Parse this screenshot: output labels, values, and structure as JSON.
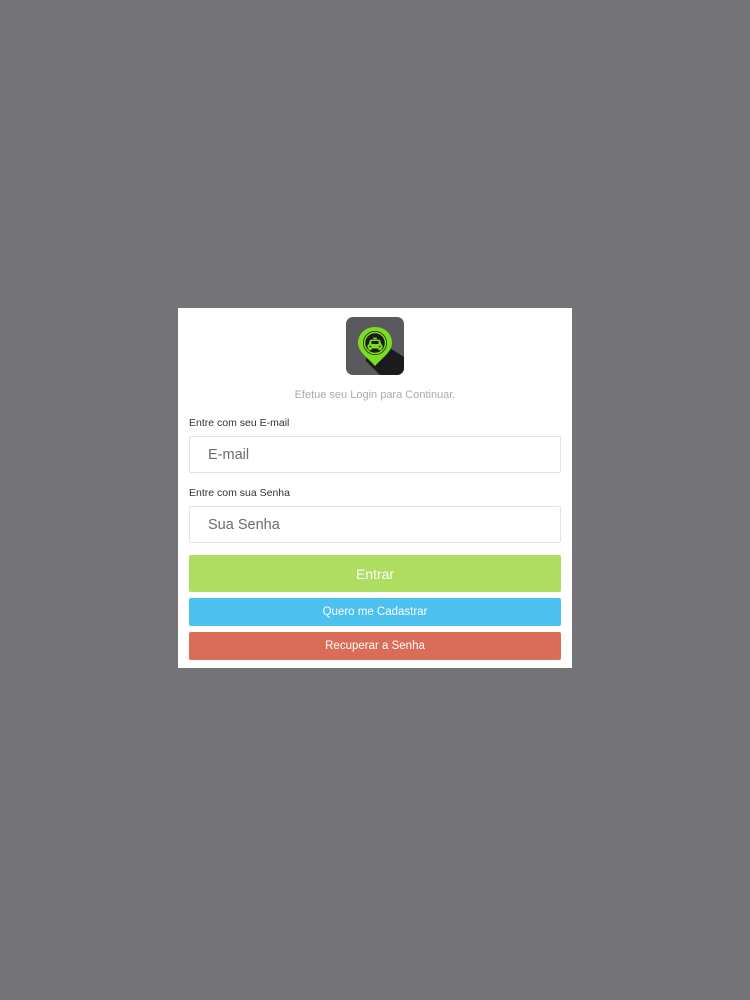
{
  "login": {
    "subtitle": "Efetue seu Login para Continuar.",
    "email_label": "Entre com seu E-mail",
    "email_placeholder": "E-mail",
    "password_label": "Entre com sua Senha",
    "password_placeholder": "Sua Senha",
    "submit_label": "Entrar",
    "register_label": "Quero me Cadastrar",
    "recover_label": "Recuperar a Senha"
  },
  "logo": {
    "icon": "taxi-location-pin-icon",
    "accent_color": "#7ddc1f"
  },
  "colors": {
    "background": "#737378",
    "submit": "#aedd62",
    "register": "#4cc0ef",
    "recover": "#d96d57"
  }
}
